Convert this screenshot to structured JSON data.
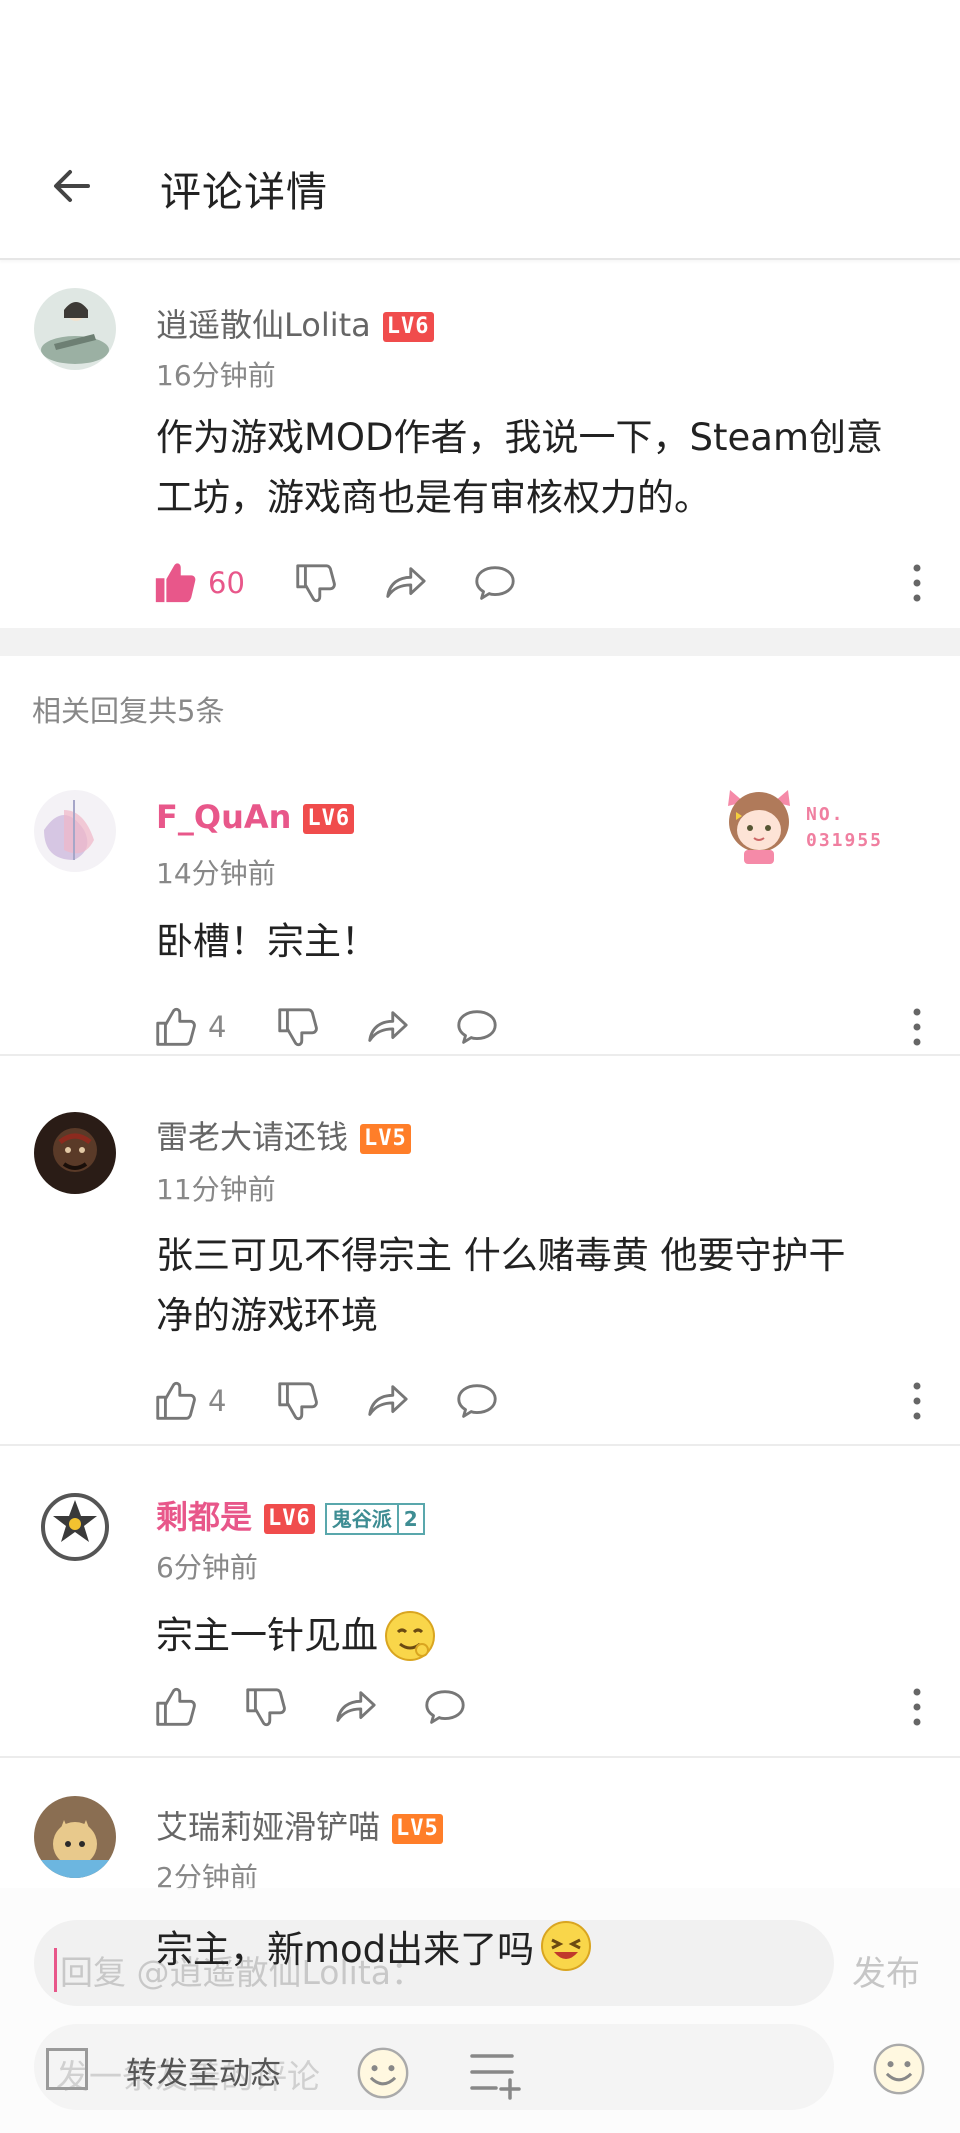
{
  "header": {
    "title": "评论详情"
  },
  "main_comment": {
    "username": "逍遥散仙Lolita",
    "level": "LV6",
    "time": "16分钟前",
    "text_line1": "作为游戏MOD作者，我说一下，Steam创意",
    "text_line2": "工坊，游戏商也是有审核权力的。",
    "likes": "60",
    "liked": true
  },
  "related_label": "相关回复共5条",
  "replies": [
    {
      "username": "F_QuAn",
      "level": "LV6",
      "time": "14分钟前",
      "text": "卧槽！宗主！",
      "likes": "4",
      "badge_no": "NO.",
      "badge_num": "031955"
    },
    {
      "username": "雷老大请还钱",
      "level": "LV5",
      "time": "11分钟前",
      "text_line1": "张三可见不得宗主 什么赌毒黄 他要守护干",
      "text_line2": "净的游戏环境",
      "likes": "4"
    },
    {
      "username": "剩都是",
      "level": "LV6",
      "faction": "鬼谷派",
      "faction_level": "2",
      "time": "6分钟前",
      "text": "宗主一针见血"
    },
    {
      "username": "艾瑞莉娅滑铲喵",
      "level": "LV5",
      "time": "2分钟前",
      "text": "宗主，新mod出来了吗"
    }
  ],
  "composer": {
    "reply_placeholder": "回复 @逍遥散仙Lolita：",
    "publish_label": "发布",
    "note_placeholder": "发一条友善的评论",
    "repost_label": "转发至动态"
  },
  "colors": {
    "accent_pink": "#e8578a",
    "lv6": "#f04c4c",
    "lv5": "#ff7e29"
  }
}
